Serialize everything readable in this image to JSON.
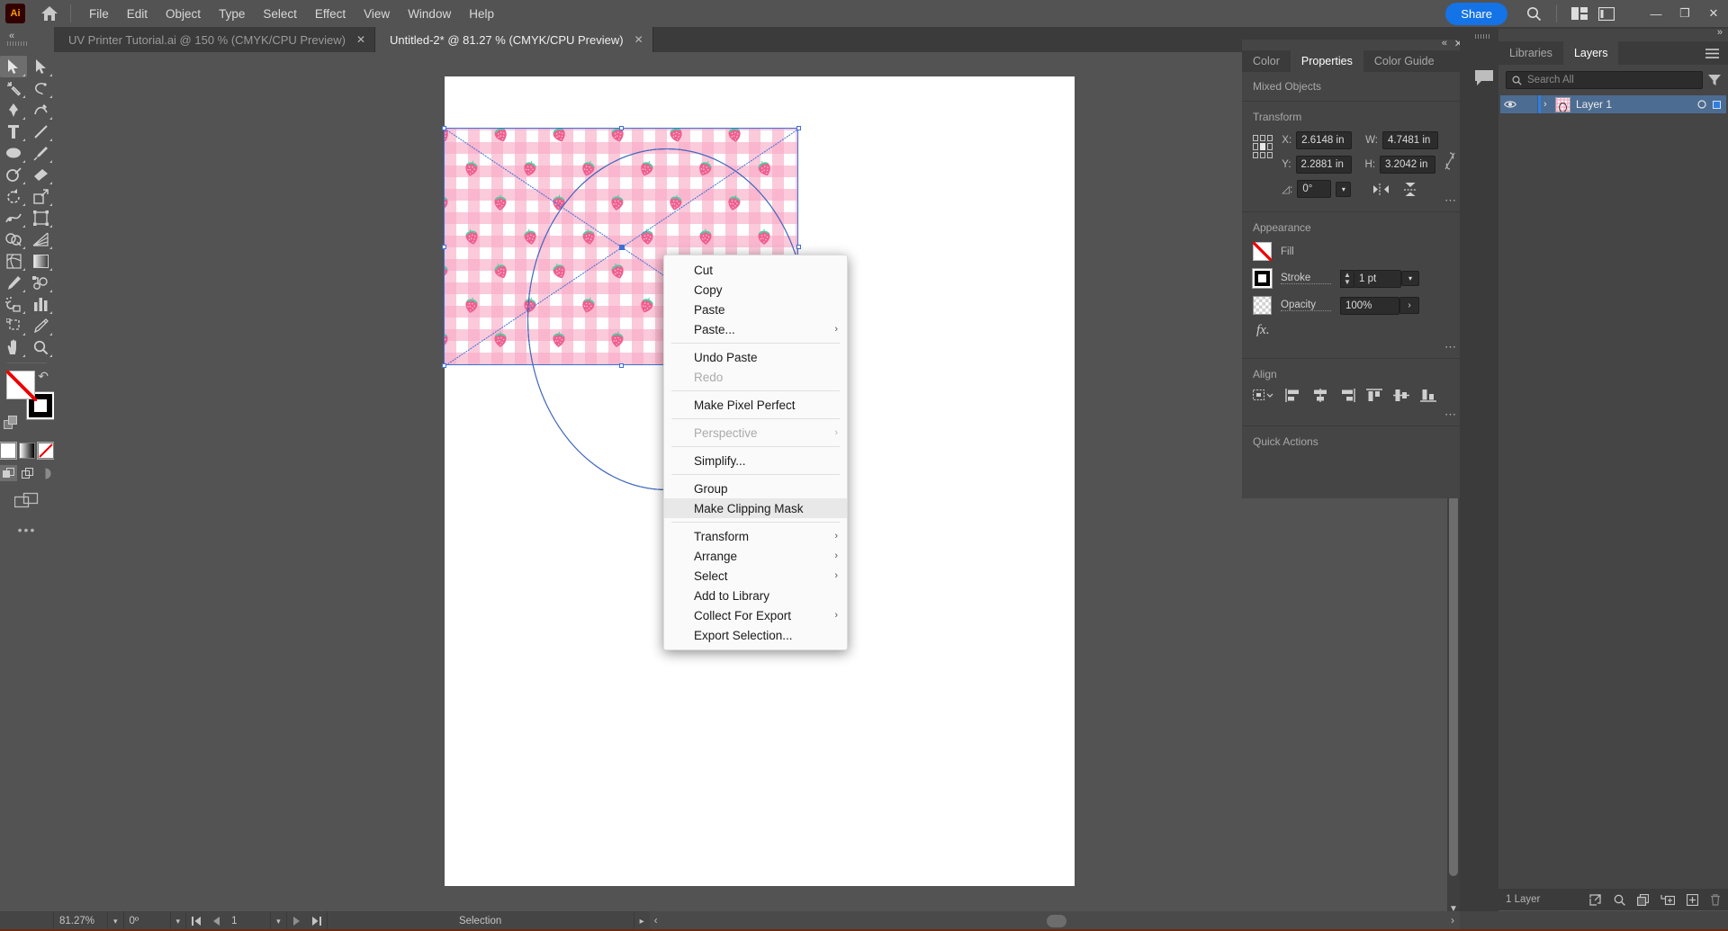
{
  "app": {
    "name": "Adobe Illustrator",
    "logo_text": "Ai",
    "logo_icon": "illustrator-logo-icon",
    "home_icon": "home-icon"
  },
  "menubar": {
    "items": [
      "File",
      "Edit",
      "Object",
      "Type",
      "Select",
      "Effect",
      "View",
      "Window",
      "Help"
    ],
    "share_label": "Share",
    "search_icon": "search-icon",
    "arrange_icon": "arrange-documents-icon",
    "workspace_icon": "workspace-switcher-icon",
    "window_minimize": "—",
    "window_restore": "❐",
    "window_close": "✕"
  },
  "tabs": [
    {
      "title": "UV Printer Tutorial.ai @ 150 % (CMYK/CPU Preview)",
      "active": false,
      "close": "✕"
    },
    {
      "title": "Untitled-2* @ 81.27 % (CMYK/CPU Preview)",
      "active": true,
      "close": "✕"
    }
  ],
  "toolbar": {
    "tools": [
      {
        "name": "selection-tool",
        "active": true
      },
      {
        "name": "direct-selection-tool",
        "active": false
      },
      {
        "name": "magic-wand-tool",
        "active": false
      },
      {
        "name": "lasso-tool",
        "active": false
      },
      {
        "name": "pen-tool",
        "active": false
      },
      {
        "name": "curvature-tool",
        "active": false
      },
      {
        "name": "type-tool",
        "active": false
      },
      {
        "name": "line-segment-tool",
        "active": false
      },
      {
        "name": "ellipse-tool",
        "active": false
      },
      {
        "name": "paintbrush-tool",
        "active": false
      },
      {
        "name": "shaper-tool",
        "active": false
      },
      {
        "name": "eraser-tool",
        "active": false
      },
      {
        "name": "rotate-tool",
        "active": false
      },
      {
        "name": "scale-tool",
        "active": false
      },
      {
        "name": "width-tool",
        "active": false
      },
      {
        "name": "free-transform-tool",
        "active": false
      },
      {
        "name": "shape-builder-tool",
        "active": false
      },
      {
        "name": "perspective-grid-tool",
        "active": false
      },
      {
        "name": "mesh-tool",
        "active": false
      },
      {
        "name": "gradient-tool",
        "active": false
      },
      {
        "name": "eyedropper-tool",
        "active": false
      },
      {
        "name": "blend-tool",
        "active": false
      },
      {
        "name": "symbol-sprayer-tool",
        "active": false
      },
      {
        "name": "column-graph-tool",
        "active": false
      },
      {
        "name": "artboard-tool",
        "active": false
      },
      {
        "name": "slice-tool",
        "active": false
      },
      {
        "name": "hand-tool",
        "active": false
      },
      {
        "name": "zoom-tool",
        "active": false
      }
    ],
    "fill_swatch": "none",
    "stroke_swatch": "black",
    "color_modes": [
      "color-swatch",
      "gradient-swatch",
      "none-swatch"
    ],
    "draw_modes": [
      "draw-normal",
      "draw-behind",
      "draw-inside"
    ],
    "screen_mode": "change-screen-mode-icon",
    "more_label": "•••"
  },
  "canvas": {
    "artwork_name": "strawberry-gingham-pattern",
    "overlay_shape": "ellipse-outline",
    "selection": "bounding-box-with-diagonals",
    "pattern_colors": {
      "gingham_pink": "#f8a9c5",
      "background": "#ffffff",
      "berry_body": "#f0608f",
      "berry_leaf": "#5fc9a0"
    }
  },
  "context_menu": {
    "items": [
      {
        "label": "Cut",
        "submenu": false,
        "disabled": false,
        "highlighted": false
      },
      {
        "label": "Copy",
        "submenu": false,
        "disabled": false,
        "highlighted": false
      },
      {
        "label": "Paste",
        "submenu": false,
        "disabled": false,
        "highlighted": false
      },
      {
        "label": "Paste...",
        "submenu": true,
        "disabled": false,
        "highlighted": false
      },
      {
        "separator": true
      },
      {
        "label": "Undo Paste",
        "submenu": false,
        "disabled": false,
        "highlighted": false
      },
      {
        "label": "Redo",
        "submenu": false,
        "disabled": true,
        "highlighted": false
      },
      {
        "separator": true
      },
      {
        "label": "Make Pixel Perfect",
        "submenu": false,
        "disabled": false,
        "highlighted": false
      },
      {
        "separator": true
      },
      {
        "label": "Perspective",
        "submenu": true,
        "disabled": true,
        "highlighted": false
      },
      {
        "separator": true
      },
      {
        "label": "Simplify...",
        "submenu": false,
        "disabled": false,
        "highlighted": false
      },
      {
        "separator": true
      },
      {
        "label": "Group",
        "submenu": false,
        "disabled": false,
        "highlighted": false
      },
      {
        "label": "Make Clipping Mask",
        "submenu": false,
        "disabled": false,
        "highlighted": true
      },
      {
        "separator": true
      },
      {
        "label": "Transform",
        "submenu": true,
        "disabled": false,
        "highlighted": false
      },
      {
        "label": "Arrange",
        "submenu": true,
        "disabled": false,
        "highlighted": false
      },
      {
        "label": "Select",
        "submenu": true,
        "disabled": false,
        "highlighted": false
      },
      {
        "label": "Add to Library",
        "submenu": false,
        "disabled": false,
        "highlighted": false
      },
      {
        "label": "Collect For Export",
        "submenu": true,
        "disabled": false,
        "highlighted": false
      },
      {
        "label": "Export Selection...",
        "submenu": false,
        "disabled": false,
        "highlighted": false
      }
    ],
    "submenu_glyph": "›"
  },
  "properties_panel": {
    "tabs": [
      {
        "label": "Color",
        "active": false
      },
      {
        "label": "Properties",
        "active": true
      },
      {
        "label": "Color Guide",
        "active": false
      }
    ],
    "selection_label": "Mixed Objects",
    "transform": {
      "title": "Transform",
      "x_label": "X:",
      "x_value": "2.6148 in",
      "y_label": "Y:",
      "y_value": "2.2881 in",
      "w_label": "W:",
      "w_value": "4.7481 in",
      "h_label": "H:",
      "h_value": "3.2042 in",
      "angle_label": "◿:",
      "angle_value": "0°",
      "link_icon": "link-broken-icon",
      "flip_h_icon": "flip-horizontal-icon",
      "flip_v_icon": "flip-vertical-icon",
      "more_icon": "more-options-icon"
    },
    "appearance": {
      "title": "Appearance",
      "fill_label": "Fill",
      "stroke_label": "Stroke",
      "stroke_value": "1 pt",
      "opacity_label": "Opacity",
      "opacity_value": "100%",
      "fx_label": "fx.",
      "more_icon": "more-options-icon"
    },
    "align": {
      "title": "Align",
      "buttons": [
        "align-to-selection-icon",
        "align-left-icon",
        "align-horizontal-center-icon",
        "align-right-icon",
        "align-top-icon",
        "align-vertical-center-icon",
        "align-bottom-icon"
      ],
      "more_icon": "more-options-icon"
    },
    "quick_actions": {
      "title": "Quick Actions"
    },
    "collapse_icon": "«",
    "close_icon": "✕"
  },
  "layers_panel": {
    "tabs": [
      {
        "label": "Layers",
        "active": true
      },
      {
        "label": "Libraries",
        "active": false
      }
    ],
    "menu_icon": "panel-menu-icon",
    "search_placeholder": "Search All",
    "search_icon": "search-icon",
    "filter_icon": "filter-icon",
    "layers": [
      {
        "name": "Layer 1",
        "visible": true,
        "locked": false,
        "expand_glyph": "›",
        "eye_icon": "eye-icon",
        "target_icon": "target-circle-icon",
        "select_icon": "selection-square-icon"
      }
    ],
    "footer": {
      "count_label": "1 Layer",
      "icons": [
        "locate-object-icon",
        "search-layer-icon",
        "create-new-sublayer-icon",
        "collect-in-new-layer-icon",
        "create-new-layer-icon",
        "delete-selection-icon"
      ]
    }
  },
  "rail": {
    "comment_icon": "comment-icon",
    "expand_icon": "»"
  },
  "statusbar": {
    "zoom_value": "81.27%",
    "zoom_caret": "⌄",
    "rotate_value": "0º",
    "rotate_caret": "⌄",
    "nav_first": "⏮",
    "nav_prev": "◀",
    "page_value": "1",
    "page_caret": "⌄",
    "nav_next": "▶",
    "nav_last": "⏭",
    "status_text": "Selection",
    "scroll_left": "‹",
    "scroll_right": "›"
  }
}
